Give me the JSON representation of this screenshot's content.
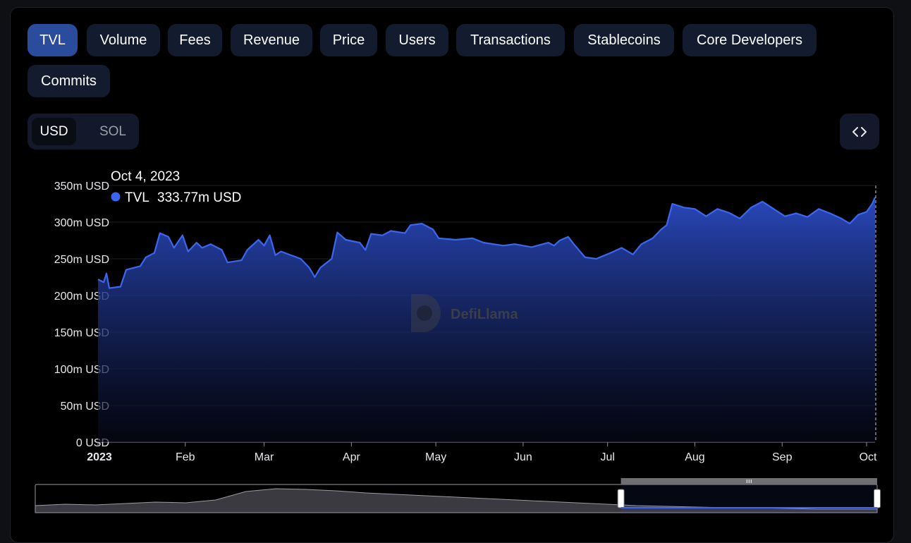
{
  "metric_tabs": [
    {
      "label": "TVL",
      "active": true
    },
    {
      "label": "Volume",
      "active": false
    },
    {
      "label": "Fees",
      "active": false
    },
    {
      "label": "Revenue",
      "active": false
    },
    {
      "label": "Price",
      "active": false
    },
    {
      "label": "Users",
      "active": false
    },
    {
      "label": "Transactions",
      "active": false
    },
    {
      "label": "Stablecoins",
      "active": false
    },
    {
      "label": "Core Developers",
      "active": false
    },
    {
      "label": "Commits",
      "active": false
    }
  ],
  "denomination": {
    "options": [
      "USD",
      "SOL"
    ],
    "selected": "USD"
  },
  "embed_icon": "code-brackets-icon",
  "watermark": {
    "text": "DefiLlama",
    "icon": "llama-logo-icon"
  },
  "colors": {
    "series": "#3c66f0",
    "area_top": "#2b4bc4",
    "area_bottom": "#07091a",
    "active_tab": "#2b4b9c",
    "tab": "#131b2e"
  },
  "tooltip": {
    "date": "Oct 4, 2023",
    "series_name": "TVL",
    "value": "333.77m USD"
  },
  "chart_data": {
    "type": "area",
    "title": "",
    "xlabel": "",
    "ylabel": "",
    "x_range": [
      "2023-01-01",
      "2023-10-04"
    ],
    "ylim": [
      0,
      350000000
    ],
    "y_ticks": [
      0,
      50000000,
      100000000,
      150000000,
      200000000,
      250000000,
      300000000,
      350000000
    ],
    "y_tick_labels": [
      "0 USD",
      "50m USD",
      "100m USD",
      "150m USD",
      "200m USD",
      "250m USD",
      "300m USD",
      "350m USD"
    ],
    "x_ticks": [
      {
        "date": "2023-01-01",
        "label": "2023",
        "bold": true
      },
      {
        "date": "2023-02-01",
        "label": "Feb"
      },
      {
        "date": "2023-03-01",
        "label": "Mar"
      },
      {
        "date": "2023-04-01",
        "label": "Apr"
      },
      {
        "date": "2023-05-01",
        "label": "May"
      },
      {
        "date": "2023-06-01",
        "label": "Jun"
      },
      {
        "date": "2023-07-01",
        "label": "Jul"
      },
      {
        "date": "2023-08-01",
        "label": "Aug"
      },
      {
        "date": "2023-09-01",
        "label": "Sep"
      },
      {
        "date": "2023-10-01",
        "label": "Oct"
      }
    ],
    "grid": true,
    "series": [
      {
        "name": "TVL",
        "points": [
          [
            "2023-01-01",
            222
          ],
          [
            "2023-01-03",
            218
          ],
          [
            "2023-01-04",
            230
          ],
          [
            "2023-01-05",
            210
          ],
          [
            "2023-01-09",
            212
          ],
          [
            "2023-01-11",
            235
          ],
          [
            "2023-01-16",
            240
          ],
          [
            "2023-01-18",
            252
          ],
          [
            "2023-01-21",
            258
          ],
          [
            "2023-01-23",
            285
          ],
          [
            "2023-01-26",
            280
          ],
          [
            "2023-01-28",
            265
          ],
          [
            "2023-01-31",
            282
          ],
          [
            "2023-02-02",
            260
          ],
          [
            "2023-02-05",
            272
          ],
          [
            "2023-02-07",
            265
          ],
          [
            "2023-02-10",
            270
          ],
          [
            "2023-02-14",
            262
          ],
          [
            "2023-02-16",
            245
          ],
          [
            "2023-02-21",
            248
          ],
          [
            "2023-02-23",
            262
          ],
          [
            "2023-02-27",
            276
          ],
          [
            "2023-03-01",
            268
          ],
          [
            "2023-03-03",
            282
          ],
          [
            "2023-03-05",
            255
          ],
          [
            "2023-03-07",
            260
          ],
          [
            "2023-03-14",
            250
          ],
          [
            "2023-03-17",
            238
          ],
          [
            "2023-03-19",
            225
          ],
          [
            "2023-03-21",
            238
          ],
          [
            "2023-03-25",
            250
          ],
          [
            "2023-03-27",
            286
          ],
          [
            "2023-03-30",
            276
          ],
          [
            "2023-04-04",
            272
          ],
          [
            "2023-04-06",
            262
          ],
          [
            "2023-04-08",
            284
          ],
          [
            "2023-04-12",
            282
          ],
          [
            "2023-04-15",
            288
          ],
          [
            "2023-04-20",
            285
          ],
          [
            "2023-04-22",
            296
          ],
          [
            "2023-04-26",
            298
          ],
          [
            "2023-04-30",
            290
          ],
          [
            "2023-05-02",
            278
          ],
          [
            "2023-05-08",
            276
          ],
          [
            "2023-05-14",
            278
          ],
          [
            "2023-05-18",
            272
          ],
          [
            "2023-05-25",
            268
          ],
          [
            "2023-05-29",
            270
          ],
          [
            "2023-06-04",
            266
          ],
          [
            "2023-06-10",
            272
          ],
          [
            "2023-06-12",
            268
          ],
          [
            "2023-06-14",
            275
          ],
          [
            "2023-06-17",
            280
          ],
          [
            "2023-06-19",
            270
          ],
          [
            "2023-06-23",
            252
          ],
          [
            "2023-06-27",
            250
          ],
          [
            "2023-07-02",
            258
          ],
          [
            "2023-07-06",
            265
          ],
          [
            "2023-07-10",
            256
          ],
          [
            "2023-07-13",
            270
          ],
          [
            "2023-07-17",
            278
          ],
          [
            "2023-07-20",
            290
          ],
          [
            "2023-07-22",
            296
          ],
          [
            "2023-07-24",
            325
          ],
          [
            "2023-07-28",
            320
          ],
          [
            "2023-08-01",
            318
          ],
          [
            "2023-08-05",
            308
          ],
          [
            "2023-08-09",
            318
          ],
          [
            "2023-08-13",
            313
          ],
          [
            "2023-08-17",
            305
          ],
          [
            "2023-08-21",
            320
          ],
          [
            "2023-08-25",
            328
          ],
          [
            "2023-08-29",
            318
          ],
          [
            "2023-09-02",
            308
          ],
          [
            "2023-09-06",
            312
          ],
          [
            "2023-09-10",
            307
          ],
          [
            "2023-09-14",
            318
          ],
          [
            "2023-09-18",
            312
          ],
          [
            "2023-09-22",
            305
          ],
          [
            "2023-09-25",
            298
          ],
          [
            "2023-09-28",
            310
          ],
          [
            "2023-10-01",
            314
          ],
          [
            "2023-10-03",
            325
          ],
          [
            "2023-10-04",
            333.77
          ]
        ],
        "value_unit": "m USD"
      }
    ],
    "legend": "tooltip"
  },
  "range_selector": {
    "start": "2023-07-12",
    "end": "2023-10-04",
    "overview_points": [
      10,
      12,
      11,
      13,
      15,
      14,
      18,
      30,
      34,
      33,
      31,
      28,
      26,
      24,
      22,
      20,
      18,
      16,
      14,
      12,
      10,
      9,
      8,
      7,
      7,
      6,
      5,
      5,
      5
    ]
  }
}
